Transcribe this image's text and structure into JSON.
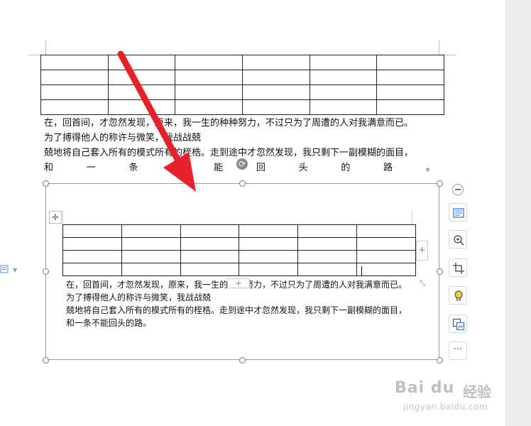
{
  "document": {
    "top_table": {
      "rows": 4,
      "cols": 6
    },
    "paragraph_lines": [
      "在，回首间，才忽然发现，原来，我一生的种种努力，不过只为了周遭的人对我满意而已。",
      "为了搏得他人的称许与微笑，我战战兢",
      "兢地将自己套入所有的模式所有的桎梏。走到途中才忽然发现，我只剩下一副模糊的面目，"
    ],
    "justified_chars": [
      "和",
      "一",
      "条",
      "不",
      "能",
      "回",
      "头",
      "的",
      "路",
      "。"
    ]
  },
  "image": {
    "inner_table": {
      "rows": 4,
      "cols": 6
    },
    "lines": [
      "在，回首间，才忽然发现，原来，我一生的种种努力，不过只为了周遭的人对我满意而已。",
      "为了搏得他人的称许与微笑，我战战兢",
      "兢地将自己套入所有的模式所有的桎梏。走到途中才忽然发现，我只剩下一副模糊的面目，",
      "和一条不能回头的路。"
    ],
    "add_column_label": "+",
    "add_row_label": "+",
    "move_handle_label": "✛",
    "resize_label": "⤡"
  },
  "sidebar": {
    "tools": [
      {
        "name": "layout-options",
        "icon": "layout-icon"
      },
      {
        "name": "zoom-image",
        "icon": "zoom-in-icon"
      },
      {
        "name": "crop-image",
        "icon": "crop-icon"
      },
      {
        "name": "image-tips",
        "icon": "lightbulb-icon"
      },
      {
        "name": "replace-image",
        "icon": "image-replace-icon"
      },
      {
        "name": "more-options",
        "icon": "more-icon",
        "label": "···"
      }
    ]
  },
  "watermark": {
    "brand": "Bai du",
    "brand_cn": "经验",
    "url": "jingyan.baidu.com"
  },
  "colors": {
    "arrow": "#e8202a",
    "page": "#ffffff",
    "frame": "#9a9a9a"
  }
}
